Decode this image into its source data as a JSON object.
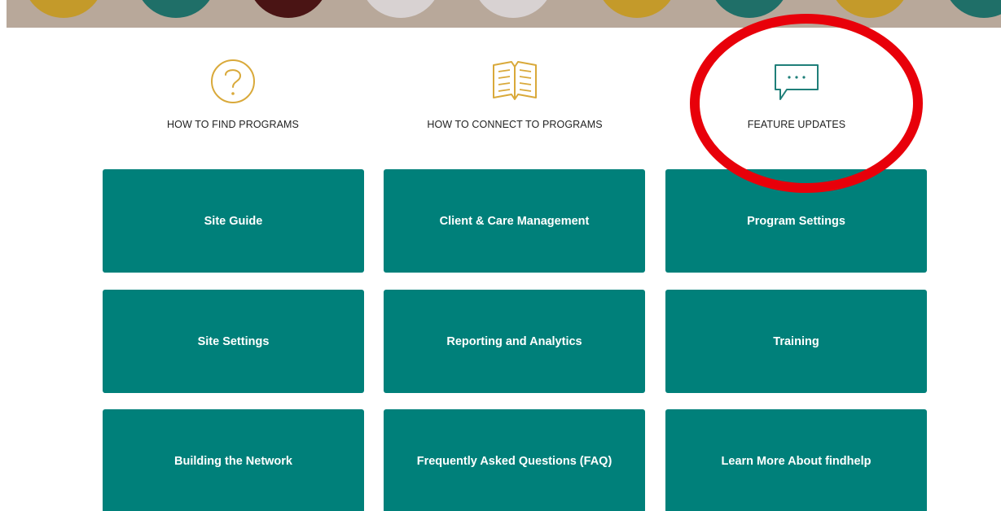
{
  "banner": {
    "circle_colors": [
      "#c49a2a",
      "#1f6f68",
      "#4a1414",
      "#d8d2d2",
      "#d8d2d2",
      "#c49a2a",
      "#1f6f68",
      "#c49a2a",
      "#1f6f68"
    ]
  },
  "quick_links": [
    {
      "label": "HOW TO FIND PROGRAMS",
      "icon": "question-circle-icon"
    },
    {
      "label": "HOW TO CONNECT TO PROGRAMS",
      "icon": "open-book-icon"
    },
    {
      "label": "FEATURE UPDATES",
      "icon": "chat-bubble-icon"
    }
  ],
  "tiles": [
    {
      "label": "Site Guide"
    },
    {
      "label": "Client & Care Management"
    },
    {
      "label": "Program Settings"
    },
    {
      "label": "Site Settings"
    },
    {
      "label": "Reporting and Analytics"
    },
    {
      "label": "Training"
    },
    {
      "label": "Building the Network"
    },
    {
      "label": "Frequently Asked Questions (FAQ)"
    },
    {
      "label": "Learn More About findhelp"
    }
  ],
  "colors": {
    "tile": "#00807a",
    "icon_gold": "#d9a93a",
    "icon_teal": "#1f7f79",
    "highlight": "#e8000a"
  }
}
